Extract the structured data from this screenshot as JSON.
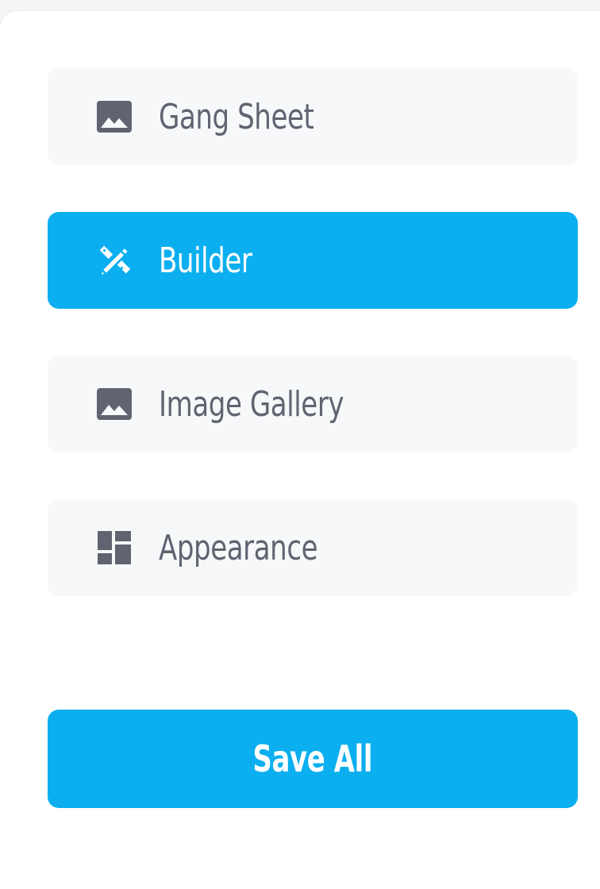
{
  "menu": {
    "items": [
      {
        "label": "Gang Sheet",
        "icon": "image-icon",
        "active": false
      },
      {
        "label": "Builder",
        "icon": "design-tools-icon",
        "active": true
      },
      {
        "label": "Image Gallery",
        "icon": "image-icon",
        "active": false
      },
      {
        "label": "Appearance",
        "icon": "dashboard-icon",
        "active": false
      }
    ]
  },
  "actions": {
    "save_all_label": "Save All"
  },
  "colors": {
    "accent": "#0bafef",
    "item_background": "#f7f8fa",
    "item_text": "#5f6470",
    "active_text": "#ffffff"
  }
}
